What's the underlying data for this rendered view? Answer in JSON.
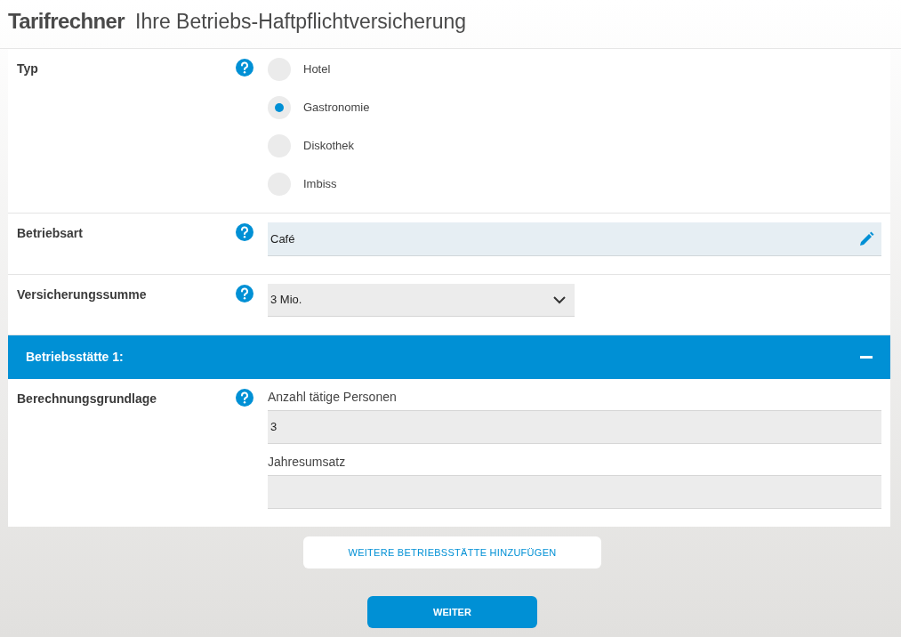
{
  "header": {
    "brand": "Tarifrechner",
    "title": "Ihre Betriebs-Haftpflichtversicherung"
  },
  "rows": [
    {
      "kind": "radio",
      "label": "Typ",
      "options": [
        {
          "label": "Hotel",
          "selected": false
        },
        {
          "label": "Gastronomie",
          "selected": true
        },
        {
          "label": "Diskothek",
          "selected": false
        },
        {
          "label": "Imbiss",
          "selected": false
        }
      ]
    },
    {
      "kind": "text",
      "label": "Betriebsart",
      "value": "Café"
    },
    {
      "kind": "select",
      "label": "Versicherungssumme",
      "value": "3 Mio."
    }
  ],
  "location": {
    "title": "Betriebsstätte 1:",
    "expanded": true,
    "row": {
      "label": "Berechnungsgrundlage",
      "fields": [
        {
          "label": "Anzahl tätige Personen",
          "value": "3"
        },
        {
          "label": "Jahresumsatz"
        }
      ]
    }
  },
  "add_button": "WEITERE BETRIEBSSTÄTTE HINZUFÜGEN",
  "next_button": "WEITER"
}
